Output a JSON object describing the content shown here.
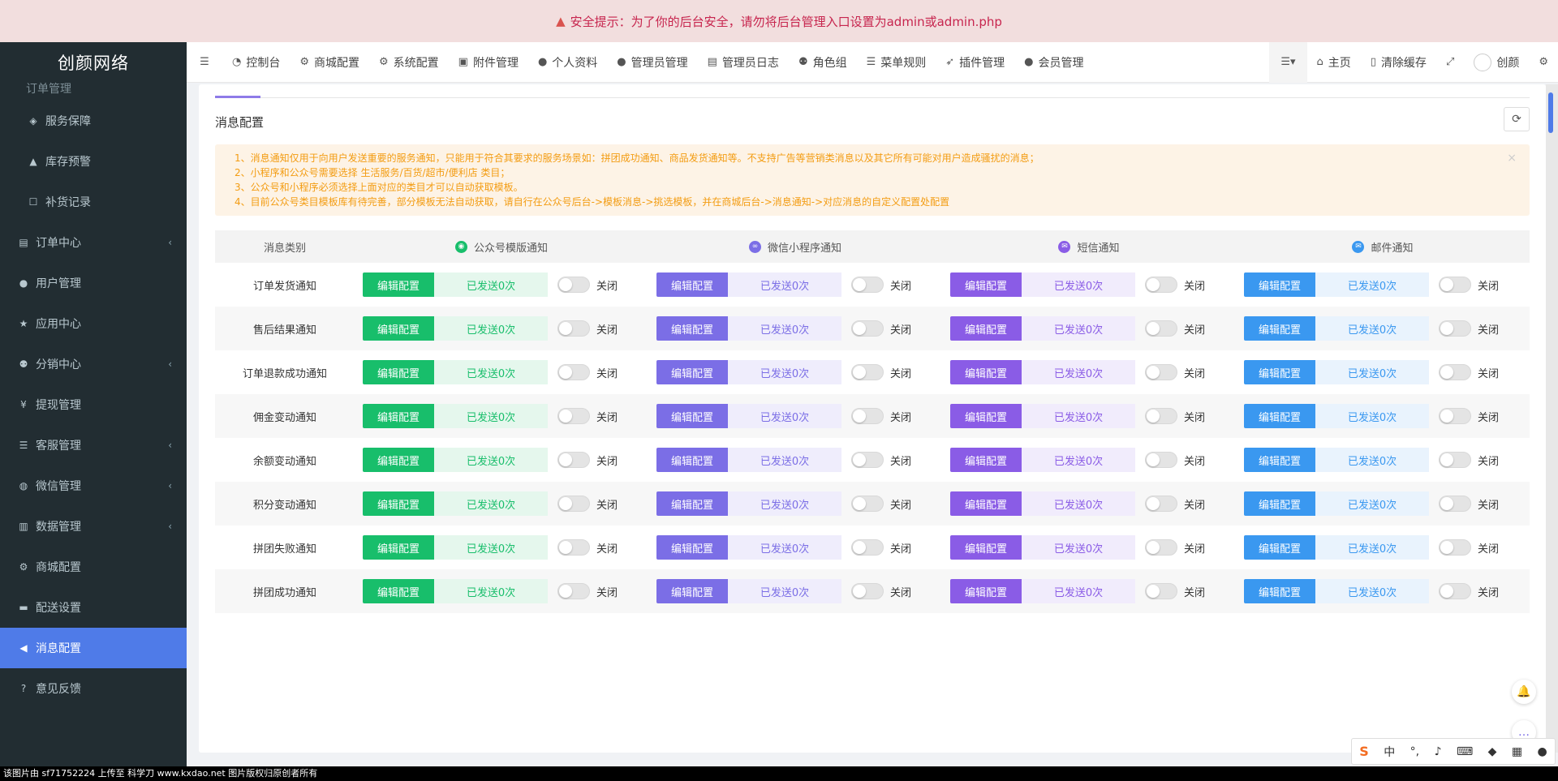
{
  "alert": {
    "icon": "warning-icon",
    "text": "安全提示：为了你的后台安全，请勿将后台管理入口设置为admin或admin.php"
  },
  "brand": "创颜网络",
  "sidebar": {
    "partial_label": "订单管理",
    "items": [
      {
        "label": "服务保障",
        "icon": "tags-icon",
        "sub": true,
        "chev": false
      },
      {
        "label": "库存预警",
        "icon": "warning-icon",
        "sub": true,
        "chev": false
      },
      {
        "label": "补货记录",
        "icon": "square-icon",
        "sub": true,
        "chev": false
      },
      {
        "label": "订单中心",
        "icon": "file-icon",
        "sub": false,
        "chev": true
      },
      {
        "label": "用户管理",
        "icon": "user-icon",
        "sub": false,
        "chev": false
      },
      {
        "label": "应用中心",
        "icon": "star-icon",
        "sub": false,
        "chev": false
      },
      {
        "label": "分销中心",
        "icon": "users-icon",
        "sub": false,
        "chev": true
      },
      {
        "label": "提现管理",
        "icon": "yen-icon",
        "sub": false,
        "chev": false
      },
      {
        "label": "客服管理",
        "icon": "list-icon",
        "sub": false,
        "chev": true
      },
      {
        "label": "微信管理",
        "icon": "wechat-icon",
        "sub": false,
        "chev": true
      },
      {
        "label": "数据管理",
        "icon": "bar-chart-icon",
        "sub": false,
        "chev": true
      },
      {
        "label": "商城配置",
        "icon": "gears-icon",
        "sub": false,
        "chev": false
      },
      {
        "label": "配送设置",
        "icon": "car-icon",
        "sub": false,
        "chev": false
      },
      {
        "label": "消息配置",
        "icon": "bullhorn-icon",
        "sub": false,
        "chev": false,
        "active": true
      },
      {
        "label": "意见反馈",
        "icon": "question-icon",
        "sub": false,
        "chev": false
      }
    ]
  },
  "navbar": {
    "items": [
      {
        "label": "控制台",
        "icon": "dashboard-icon"
      },
      {
        "label": "商城配置",
        "icon": "gears-icon"
      },
      {
        "label": "系统配置",
        "icon": "gear-icon"
      },
      {
        "label": "附件管理",
        "icon": "image-icon"
      },
      {
        "label": "个人资料",
        "icon": "user-icon"
      },
      {
        "label": "管理员管理",
        "icon": "user-icon"
      },
      {
        "label": "管理员日志",
        "icon": "list-alt-icon"
      },
      {
        "label": "角色组",
        "icon": "group-icon"
      },
      {
        "label": "菜单规则",
        "icon": "bars-icon"
      },
      {
        "label": "插件管理",
        "icon": "rocket-icon"
      },
      {
        "label": "会员管理",
        "icon": "user-icon"
      }
    ],
    "right_items": [
      {
        "label": "主页",
        "icon": "home-icon"
      },
      {
        "label": "清除缓存",
        "icon": "trash-icon"
      }
    ],
    "user_name": "创颜"
  },
  "panel": {
    "title": "消息配置",
    "notice_lines": [
      "1、消息通知仅用于向用户发送重要的服务通知，只能用于符合其要求的服务场景如：拼团成功通知、商品发货通知等。不支持广告等营销类消息以及其它所有可能对用户造成骚扰的消息；",
      "2、小程序和公众号需要选择 生活服务/百货/超市/便利店 类目；",
      "3、公众号和小程序必须选择上面对应的类目才可以自动获取模板。",
      "4、目前公众号类目模板库有待完善，部分模板无法自动获取，请自行在公众号后台->模板消息->挑选模板，并在商城后台->消息通知->对应消息的自定义配置处配置"
    ]
  },
  "table": {
    "category_header": "消息类别",
    "channels": [
      {
        "name": "公众号模版通知",
        "icon": "wechat-official-icon",
        "color": "#18be6b"
      },
      {
        "name": "微信小程序通知",
        "icon": "miniprogram-icon",
        "color": "#7b6ee6"
      },
      {
        "name": "短信通知",
        "icon": "sms-icon",
        "color": "#8a5ce6"
      },
      {
        "name": "邮件通知",
        "icon": "mail-icon",
        "color": "#3a98f0"
      }
    ],
    "edit_label": "编辑配置",
    "off_label": "关闭",
    "rows": [
      {
        "category": "订单发货通知",
        "sent": [
          "已发送0次",
          "已发送0次",
          "已发送0次",
          "已发送0次"
        ]
      },
      {
        "category": "售后结果通知",
        "sent": [
          "已发送0次",
          "已发送0次",
          "已发送0次",
          "已发送0次"
        ]
      },
      {
        "category": "订单退款成功通知",
        "sent": [
          "已发送0次",
          "已发送0次",
          "已发送0次",
          "已发送0次"
        ]
      },
      {
        "category": "佣金变动通知",
        "sent": [
          "已发送0次",
          "已发送0次",
          "已发送0次",
          "已发送0次"
        ]
      },
      {
        "category": "余额变动通知",
        "sent": [
          "已发送0次",
          "已发送0次",
          "已发送0次",
          "已发送0次"
        ]
      },
      {
        "category": "积分变动通知",
        "sent": [
          "已发送0次",
          "已发送0次",
          "已发送0次",
          "已发送0次"
        ]
      },
      {
        "category": "拼团失败通知",
        "sent": [
          "已发送0次",
          "已发送0次",
          "已发送0次",
          "已发送0次"
        ]
      },
      {
        "category": "拼团成功通知",
        "sent": [
          "已发送0次",
          "已发送0次",
          "已发送0次",
          "已发送0次"
        ]
      }
    ]
  },
  "ime": {
    "logo": "S",
    "lang": "中"
  },
  "watermark": "该图片由 sf71752224 上传至 科学刀 www.kxdao.net 图片版权归原创者所有"
}
